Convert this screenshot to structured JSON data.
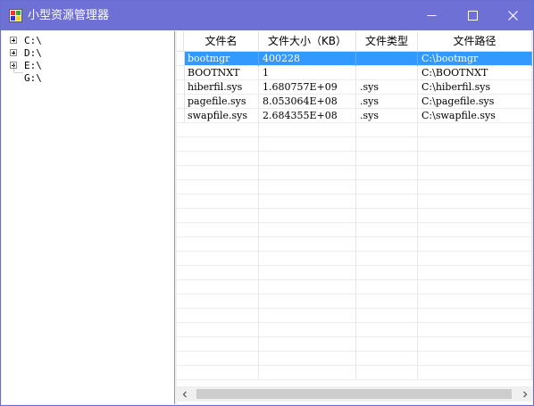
{
  "window": {
    "title": "小型资源管理器",
    "title_bar_color": "#6f70d5",
    "icons": {
      "minimize": "minimize-icon",
      "maximize": "maximize-icon",
      "close": "close-icon"
    }
  },
  "tree": {
    "nodes": [
      {
        "label": "C:\\",
        "expandable": true
      },
      {
        "label": "D:\\",
        "expandable": true
      },
      {
        "label": "E:\\",
        "expandable": true
      },
      {
        "label": "G:\\",
        "expandable": false
      }
    ]
  },
  "grid": {
    "columns": [
      "文件名",
      "文件大小（KB）",
      "文件类型",
      "文件路径"
    ],
    "rows": [
      {
        "name": "bootmgr",
        "size": "400228",
        "type": "",
        "path": "C:\\bootmgr",
        "selected": true
      },
      {
        "name": "BOOTNXT",
        "size": "1",
        "type": "",
        "path": "C:\\BOOTNXT",
        "selected": false
      },
      {
        "name": "hiberfil.sys",
        "size": "1.680757E+09",
        "type": ".sys",
        "path": "C:\\hiberfil.sys",
        "selected": false
      },
      {
        "name": "pagefile.sys",
        "size": "8.053064E+08",
        "type": ".sys",
        "path": "C:\\pagefile.sys",
        "selected": false
      },
      {
        "name": "swapfile.sys",
        "size": "2.684355E+08",
        "type": ".sys",
        "path": "C:\\swapfile.sys",
        "selected": false
      }
    ],
    "selection_color": "#3399ff"
  }
}
